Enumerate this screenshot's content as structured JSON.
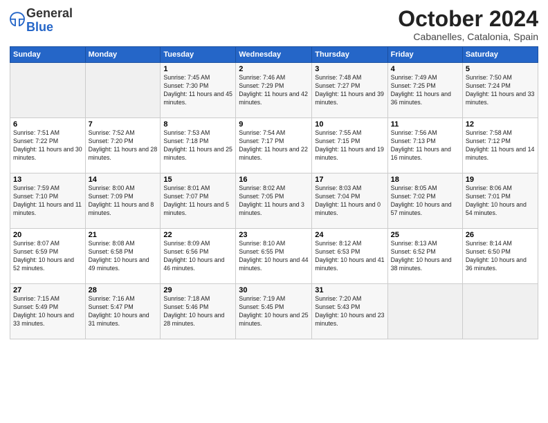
{
  "logo": {
    "general": "General",
    "blue": "Blue"
  },
  "header": {
    "month": "October 2024",
    "location": "Cabanelles, Catalonia, Spain"
  },
  "days_of_week": [
    "Sunday",
    "Monday",
    "Tuesday",
    "Wednesday",
    "Thursday",
    "Friday",
    "Saturday"
  ],
  "weeks": [
    [
      {
        "day": "",
        "sunrise": "",
        "sunset": "",
        "daylight": ""
      },
      {
        "day": "",
        "sunrise": "",
        "sunset": "",
        "daylight": ""
      },
      {
        "day": "1",
        "sunrise": "Sunrise: 7:45 AM",
        "sunset": "Sunset: 7:30 PM",
        "daylight": "Daylight: 11 hours and 45 minutes."
      },
      {
        "day": "2",
        "sunrise": "Sunrise: 7:46 AM",
        "sunset": "Sunset: 7:29 PM",
        "daylight": "Daylight: 11 hours and 42 minutes."
      },
      {
        "day": "3",
        "sunrise": "Sunrise: 7:48 AM",
        "sunset": "Sunset: 7:27 PM",
        "daylight": "Daylight: 11 hours and 39 minutes."
      },
      {
        "day": "4",
        "sunrise": "Sunrise: 7:49 AM",
        "sunset": "Sunset: 7:25 PM",
        "daylight": "Daylight: 11 hours and 36 minutes."
      },
      {
        "day": "5",
        "sunrise": "Sunrise: 7:50 AM",
        "sunset": "Sunset: 7:24 PM",
        "daylight": "Daylight: 11 hours and 33 minutes."
      }
    ],
    [
      {
        "day": "6",
        "sunrise": "Sunrise: 7:51 AM",
        "sunset": "Sunset: 7:22 PM",
        "daylight": "Daylight: 11 hours and 30 minutes."
      },
      {
        "day": "7",
        "sunrise": "Sunrise: 7:52 AM",
        "sunset": "Sunset: 7:20 PM",
        "daylight": "Daylight: 11 hours and 28 minutes."
      },
      {
        "day": "8",
        "sunrise": "Sunrise: 7:53 AM",
        "sunset": "Sunset: 7:18 PM",
        "daylight": "Daylight: 11 hours and 25 minutes."
      },
      {
        "day": "9",
        "sunrise": "Sunrise: 7:54 AM",
        "sunset": "Sunset: 7:17 PM",
        "daylight": "Daylight: 11 hours and 22 minutes."
      },
      {
        "day": "10",
        "sunrise": "Sunrise: 7:55 AM",
        "sunset": "Sunset: 7:15 PM",
        "daylight": "Daylight: 11 hours and 19 minutes."
      },
      {
        "day": "11",
        "sunrise": "Sunrise: 7:56 AM",
        "sunset": "Sunset: 7:13 PM",
        "daylight": "Daylight: 11 hours and 16 minutes."
      },
      {
        "day": "12",
        "sunrise": "Sunrise: 7:58 AM",
        "sunset": "Sunset: 7:12 PM",
        "daylight": "Daylight: 11 hours and 14 minutes."
      }
    ],
    [
      {
        "day": "13",
        "sunrise": "Sunrise: 7:59 AM",
        "sunset": "Sunset: 7:10 PM",
        "daylight": "Daylight: 11 hours and 11 minutes."
      },
      {
        "day": "14",
        "sunrise": "Sunrise: 8:00 AM",
        "sunset": "Sunset: 7:09 PM",
        "daylight": "Daylight: 11 hours and 8 minutes."
      },
      {
        "day": "15",
        "sunrise": "Sunrise: 8:01 AM",
        "sunset": "Sunset: 7:07 PM",
        "daylight": "Daylight: 11 hours and 5 minutes."
      },
      {
        "day": "16",
        "sunrise": "Sunrise: 8:02 AM",
        "sunset": "Sunset: 7:05 PM",
        "daylight": "Daylight: 11 hours and 3 minutes."
      },
      {
        "day": "17",
        "sunrise": "Sunrise: 8:03 AM",
        "sunset": "Sunset: 7:04 PM",
        "daylight": "Daylight: 11 hours and 0 minutes."
      },
      {
        "day": "18",
        "sunrise": "Sunrise: 8:05 AM",
        "sunset": "Sunset: 7:02 PM",
        "daylight": "Daylight: 10 hours and 57 minutes."
      },
      {
        "day": "19",
        "sunrise": "Sunrise: 8:06 AM",
        "sunset": "Sunset: 7:01 PM",
        "daylight": "Daylight: 10 hours and 54 minutes."
      }
    ],
    [
      {
        "day": "20",
        "sunrise": "Sunrise: 8:07 AM",
        "sunset": "Sunset: 6:59 PM",
        "daylight": "Daylight: 10 hours and 52 minutes."
      },
      {
        "day": "21",
        "sunrise": "Sunrise: 8:08 AM",
        "sunset": "Sunset: 6:58 PM",
        "daylight": "Daylight: 10 hours and 49 minutes."
      },
      {
        "day": "22",
        "sunrise": "Sunrise: 8:09 AM",
        "sunset": "Sunset: 6:56 PM",
        "daylight": "Daylight: 10 hours and 46 minutes."
      },
      {
        "day": "23",
        "sunrise": "Sunrise: 8:10 AM",
        "sunset": "Sunset: 6:55 PM",
        "daylight": "Daylight: 10 hours and 44 minutes."
      },
      {
        "day": "24",
        "sunrise": "Sunrise: 8:12 AM",
        "sunset": "Sunset: 6:53 PM",
        "daylight": "Daylight: 10 hours and 41 minutes."
      },
      {
        "day": "25",
        "sunrise": "Sunrise: 8:13 AM",
        "sunset": "Sunset: 6:52 PM",
        "daylight": "Daylight: 10 hours and 38 minutes."
      },
      {
        "day": "26",
        "sunrise": "Sunrise: 8:14 AM",
        "sunset": "Sunset: 6:50 PM",
        "daylight": "Daylight: 10 hours and 36 minutes."
      }
    ],
    [
      {
        "day": "27",
        "sunrise": "Sunrise: 7:15 AM",
        "sunset": "Sunset: 5:49 PM",
        "daylight": "Daylight: 10 hours and 33 minutes."
      },
      {
        "day": "28",
        "sunrise": "Sunrise: 7:16 AM",
        "sunset": "Sunset: 5:47 PM",
        "daylight": "Daylight: 10 hours and 31 minutes."
      },
      {
        "day": "29",
        "sunrise": "Sunrise: 7:18 AM",
        "sunset": "Sunset: 5:46 PM",
        "daylight": "Daylight: 10 hours and 28 minutes."
      },
      {
        "day": "30",
        "sunrise": "Sunrise: 7:19 AM",
        "sunset": "Sunset: 5:45 PM",
        "daylight": "Daylight: 10 hours and 25 minutes."
      },
      {
        "day": "31",
        "sunrise": "Sunrise: 7:20 AM",
        "sunset": "Sunset: 5:43 PM",
        "daylight": "Daylight: 10 hours and 23 minutes."
      },
      {
        "day": "",
        "sunrise": "",
        "sunset": "",
        "daylight": ""
      },
      {
        "day": "",
        "sunrise": "",
        "sunset": "",
        "daylight": ""
      }
    ]
  ]
}
